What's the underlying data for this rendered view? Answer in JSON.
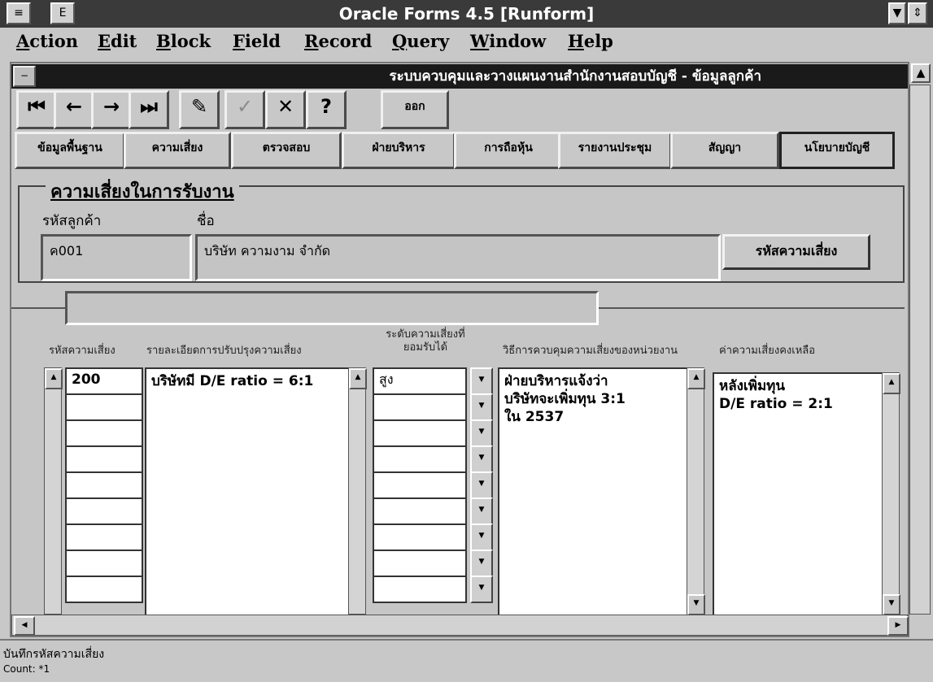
{
  "app": {
    "title": "Oracle Forms 4.5 [Runform]"
  },
  "menu": [
    "Action",
    "Edit",
    "Block",
    "Field",
    "Record",
    "Query",
    "Window",
    "Help"
  ],
  "window": {
    "title": "ระบบควบคุมและวางแผนงานสำนักงานสอบบัญชี - ข้อมูลลูกค้า"
  },
  "toolbar": {
    "exit_label": "ออก"
  },
  "tabs": [
    "ข้อมูลพื้นฐาน",
    "ความเสี่ยง",
    "ตรวจสอบ",
    "ฝ่ายบริหาร",
    "การถือหุ้น",
    "รายงานประชุม",
    "สัญญา",
    "นโยบายบัญชี"
  ],
  "header": {
    "frame_title": "ความเสี่ยงในการรับงาน",
    "customer_code_label": "รหัสลูกค้า",
    "customer_code": "ค001",
    "name_label": "ชื่อ",
    "name_value": "บริษัท ความงาม จำกัด",
    "risk_code_button": "รหัสความเสี่ยง"
  },
  "columns": {
    "risk_code": "รหัสความเสี่ยง",
    "detail": "รายละเอียดการปรับปรุงความเสี่ยง",
    "level": "ระดับความเสี่ยงที่ยอมรับได้",
    "method": "วิธีการควบคุมความเสี่ยงของหน่วยงาน",
    "remaining": "ค่าความเสี่ยงคงเหลือ"
  },
  "record": {
    "risk_code": "200",
    "detail": "บริษัทมี D/E ratio = 6:1",
    "level": "สูง",
    "method": "ฝ่ายบริหารแจ้งว่า\nบริษัทจะเพิ่มทุน 3:1\nใน 2537",
    "remaining": "หลังเพิ่มทุน\nD/E ratio = 2:1"
  },
  "status": {
    "message": "บันทึกรหัสความเสี่ยง",
    "count": "Count: *1"
  }
}
